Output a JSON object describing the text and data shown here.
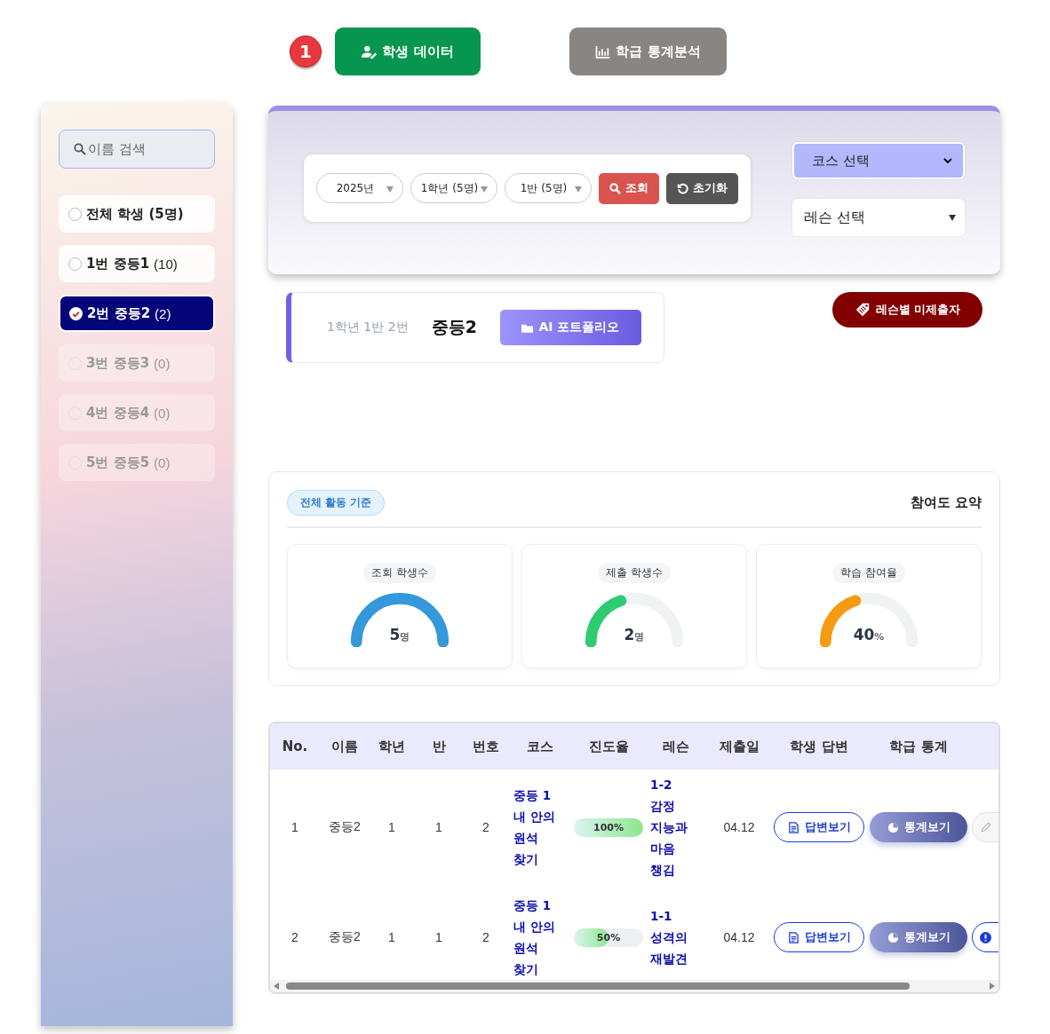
{
  "top_nav": {
    "step_badge": "1",
    "tabs": [
      {
        "label": "학생 데이터",
        "selected": true
      },
      {
        "label": "학급 통계분석",
        "selected": false
      }
    ]
  },
  "sidebar": {
    "search": {
      "placeholder": "이름 검색"
    },
    "items": [
      {
        "name": "전체 학생 (5명)",
        "selected": false,
        "disabled": false
      },
      {
        "name": "1번 중등1",
        "count": "(10)",
        "selected": false,
        "disabled": false
      },
      {
        "name": "2번 중등2",
        "count": "(2)",
        "selected": true,
        "disabled": false
      },
      {
        "name": "3번 중등3",
        "count": "(0)",
        "selected": false,
        "disabled": true
      },
      {
        "name": "4번 중등4",
        "count": "(0)",
        "selected": false,
        "disabled": true
      },
      {
        "name": "5번 중등5",
        "count": "(0)",
        "selected": false,
        "disabled": true
      }
    ]
  },
  "filters": {
    "dropdowns": [
      "2025년",
      "1학년 (5명)",
      "1반 (5명)"
    ],
    "search_button": "조회",
    "reset_button": "초기화"
  },
  "selects": [
    {
      "value": "코스 선택",
      "highlighted": true
    },
    {
      "value": "레슨 선택",
      "highlighted": false
    }
  ],
  "student_card": {
    "info": "1학년 1반 2번",
    "name": "중등2",
    "portfolio_button": "AI 포트폴리오"
  },
  "missing_button": "레슨별 미제출자",
  "summary": {
    "tag": "전체 활동 기준",
    "title": "참여도 요약",
    "gauges": [
      {
        "label": "조회 학생수",
        "value": "5",
        "unit": "명",
        "color": "#3498db"
      },
      {
        "label": "제출 학생수",
        "value": "2",
        "unit": "명",
        "color": "#2ecc71"
      },
      {
        "label": "학습 참여율",
        "value": "40",
        "unit": "%",
        "color": "#f39c12"
      }
    ]
  },
  "table": {
    "columns": [
      "No.",
      "이름",
      "학년",
      "반",
      "번호",
      "코스",
      "진도율",
      "레슨",
      "제출일",
      "학생 답변",
      "학급 통계"
    ],
    "rows": [
      {
        "no": "1",
        "name": "중등2",
        "grade": "1",
        "class": "1",
        "number": "2",
        "course": "중등 1 내 안의 원석 찾기",
        "progress": "100%",
        "level": 1,
        "lesson": "1-2 감정 지능과 마음 챙김",
        "date": "04.12",
        "answer_button": "답변보기",
        "stats_button": "통계보기",
        "kind": "edit"
      },
      {
        "no": "2",
        "name": "중등2",
        "grade": "1",
        "class": "1",
        "number": "2",
        "course": "중등 1 내 안의 원석 찾기",
        "progress": "50%",
        "level": 0.5,
        "lesson": "1-1 성격의 재발견",
        "date": "04.12",
        "answer_button": "답변보기",
        "stats_button": "통계보기",
        "kind": "alert"
      }
    ]
  }
}
